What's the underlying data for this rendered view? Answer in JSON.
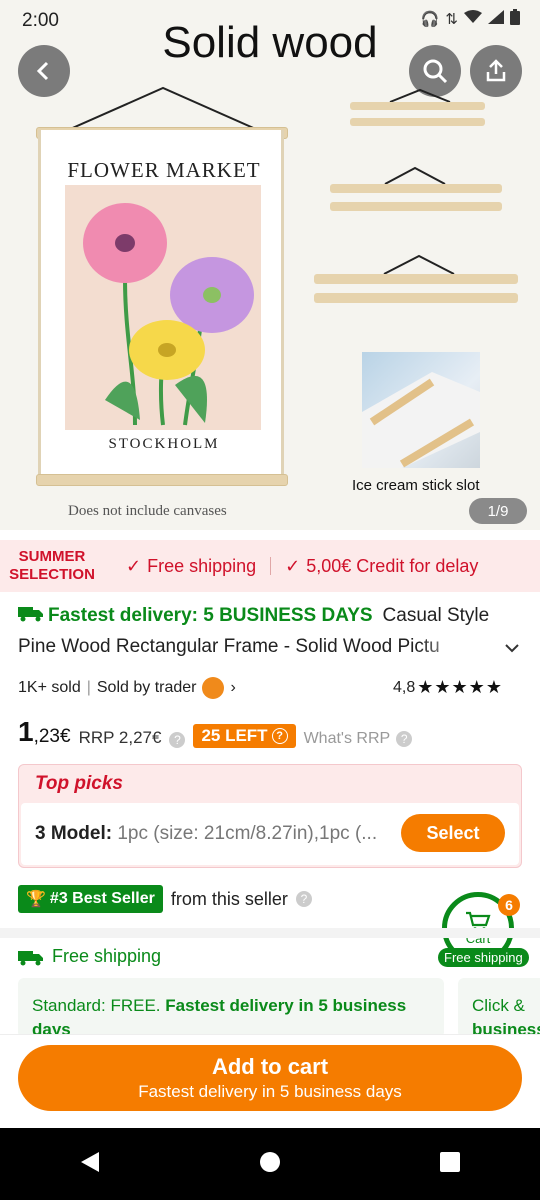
{
  "status_bar": {
    "time": "2:00"
  },
  "hero": {
    "title": "Solid wood",
    "poster_title": "FLOWER MARKET",
    "poster_subtitle": "STOCKHOLM",
    "note": "Does not include canvases",
    "photo_caption": "Ice cream stick slot",
    "page_indicator": "1/9"
  },
  "promo": {
    "badge_line1": "SUMMER",
    "badge_line2": "SELECTION",
    "free_shipping": "Free shipping",
    "credit": "5,00€ Credit for delay"
  },
  "product": {
    "fastest_delivery": "Fastest delivery: 5 BUSINESS DAYS",
    "title_part1": "Casual Style",
    "title_line2": "Pine Wood Rectangular Frame - Solid Wood Pictu",
    "sold": "1K+ sold",
    "sold_by": "Sold by trader",
    "rating": "4,8",
    "price_int": "1",
    "price_dec": ",23€",
    "rrp_label": "RRP",
    "rrp_value": "2,27€",
    "stock_badge": "25 LEFT",
    "whats_rrp": "What's RRP"
  },
  "top_picks": {
    "title": "Top picks",
    "model_label": "3 Model:",
    "model_value": "1pc (size: 21cm/8.27in),1pc (...",
    "select_label": "Select"
  },
  "best_seller": {
    "badge": "#3 Best Seller",
    "text": "from this seller"
  },
  "cart": {
    "label": "Cart",
    "count": "6",
    "free_shipping": "Free shipping"
  },
  "shipping": {
    "title": "Free shipping",
    "standard_prefix": "Standard: FREE.",
    "standard_bold": "Fastest delivery in 5 business",
    "standard_line2": "days",
    "second_line1": "Click &",
    "second_line2": "business"
  },
  "bottom": {
    "add_to_cart": "Add to cart",
    "sub": "Fastest delivery in 5 business days"
  },
  "colors": {
    "accent_orange": "#f57c00",
    "green": "#0a8a1a",
    "red": "#d0122b"
  }
}
